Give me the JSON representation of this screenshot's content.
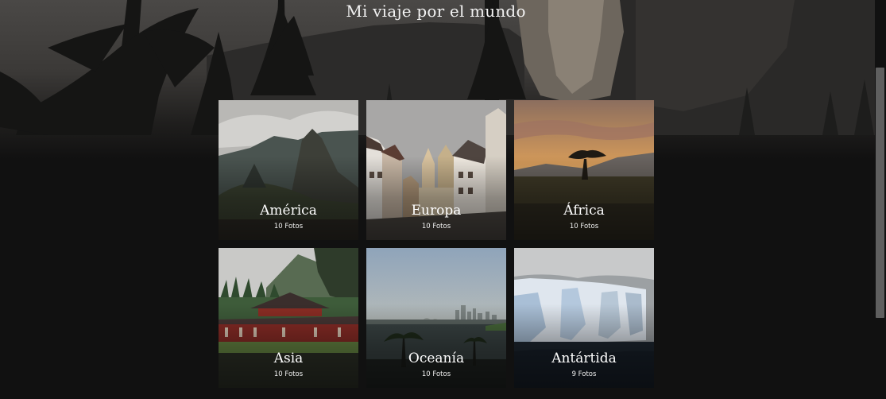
{
  "page": {
    "title": "Mi viaje por el mundo"
  },
  "gallery": {
    "cards": [
      {
        "label": "América",
        "count": "10 Fotos",
        "icon": "mountain-photo"
      },
      {
        "label": "Europa",
        "count": "10 Fotos",
        "icon": "old-town-photo"
      },
      {
        "label": "África",
        "count": "10 Fotos",
        "icon": "savanna-photo"
      },
      {
        "label": "Asia",
        "count": "10 Fotos",
        "icon": "temple-photo"
      },
      {
        "label": "Oceanía",
        "count": "10 Fotos",
        "icon": "harbor-city-photo"
      },
      {
        "label": "Antártida",
        "count": "9 Fotos",
        "icon": "glacier-photo"
      }
    ]
  },
  "scrollbar": {
    "position": 0.17
  },
  "colors": {
    "background": "#111111",
    "text": "#ffffff"
  }
}
